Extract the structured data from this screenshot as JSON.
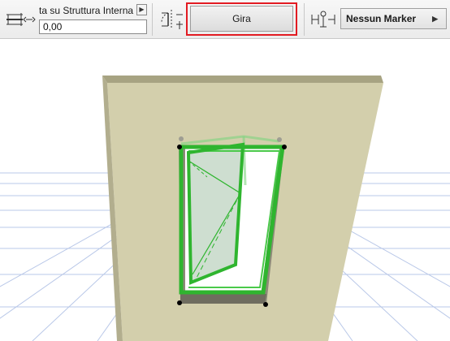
{
  "toolbar": {
    "reference_label": "ta su Struttura Interna",
    "offset_value": "0,00",
    "rotate_button_label": "Gira",
    "marker_select_value": "Nessun Marker"
  },
  "icons": {
    "reference_line": "wall-reference-line-icon",
    "opening_direction": "opening-direction-icon",
    "marker": "marker-icon",
    "dropdown": "chevron-right-icon"
  },
  "colors": {
    "highlight": "#e21b22",
    "window_frame": "#2fb52f",
    "wall_face": "#d3cfac",
    "grid_line": "#b9c8e8"
  }
}
